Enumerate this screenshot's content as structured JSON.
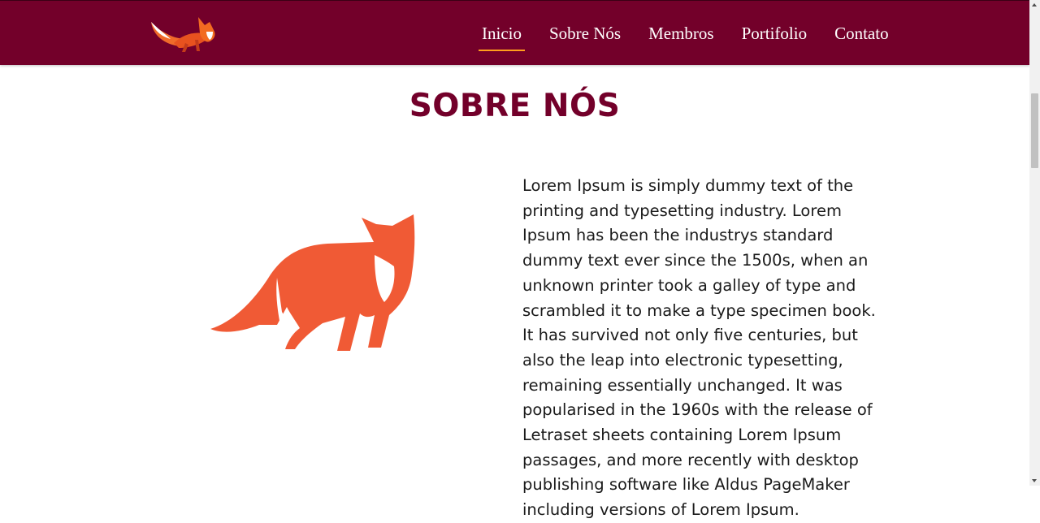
{
  "navbar": {
    "logo": "fox-logo-icon",
    "links": [
      {
        "label": "Inicio",
        "active": true
      },
      {
        "label": "Sobre Nós",
        "active": false
      },
      {
        "label": "Membros",
        "active": false
      },
      {
        "label": "Portifolio",
        "active": false
      },
      {
        "label": "Contato",
        "active": false
      }
    ]
  },
  "about": {
    "title": "SOBRE NÓS",
    "image": "fox-illustration-icon",
    "text": "Lorem Ipsum is simply dummy text of the printing and typesetting industry. Lorem Ipsum has been the industrys standard dummy text ever since the 1500s, when an unknown printer took a galley of type and scrambled it to make a type specimen book. It has survived not only five centuries, but also the leap into electronic typesetting, remaining essentially unchanged. It was popularised in the 1960s with the release of Letraset sheets containing Lorem Ipsum passages, and more recently with desktop publishing software like Aldus PageMaker including versions of Lorem Ipsum."
  },
  "colors": {
    "navbar_bg": "#73002a",
    "heading": "#73002a",
    "active_underline": "#ff9f1c",
    "fox": "#f05a35"
  }
}
